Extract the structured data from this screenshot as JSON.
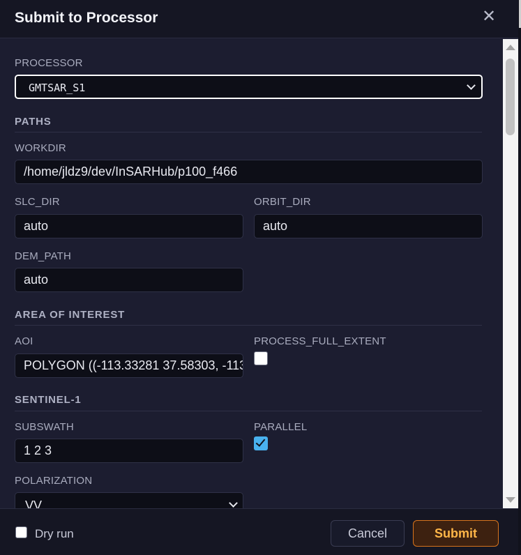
{
  "dialog": {
    "title": "Submit to Processor",
    "close_glyph": "✕",
    "close_icon": "close-icon"
  },
  "processor": {
    "label": "PROCESSOR",
    "selected": "GMTSAR_S1",
    "chevron_icon": "chevron-down-icon"
  },
  "sections": {
    "paths": "PATHS",
    "area_of_interest": "AREA OF INTEREST",
    "sentinel1": "SENTINEL-1"
  },
  "fields": {
    "workdir": {
      "label": "WORKDIR",
      "value": "/home/jldz9/dev/InSARHub/p100_f466"
    },
    "slc_dir": {
      "label": "SLC_DIR",
      "value": "auto"
    },
    "orbit_dir": {
      "label": "ORBIT_DIR",
      "value": "auto"
    },
    "dem_path": {
      "label": "DEM_PATH",
      "value": "auto"
    },
    "aoi": {
      "label": "AOI",
      "value": "POLYGON ((-113.33281 37.58303, -113"
    },
    "process_full_extent": {
      "label": "PROCESS_FULL_EXTENT",
      "checked": false
    },
    "subswath": {
      "label": "SUBSWATH",
      "value": "1 2 3"
    },
    "parallel": {
      "label": "PARALLEL",
      "checked": true
    },
    "polarization": {
      "label": "POLARIZATION",
      "value": "VV"
    }
  },
  "footer": {
    "dry_run_label": "Dry run",
    "dry_run_checked": false,
    "cancel_label": "Cancel",
    "submit_label": "Submit"
  },
  "colors": {
    "background": "#1c1d30",
    "input_bg": "#0d0e17",
    "checkbox_checked": "#49b1ee",
    "submit_accent": "#d8741c",
    "submit_text": "#ffb648"
  }
}
